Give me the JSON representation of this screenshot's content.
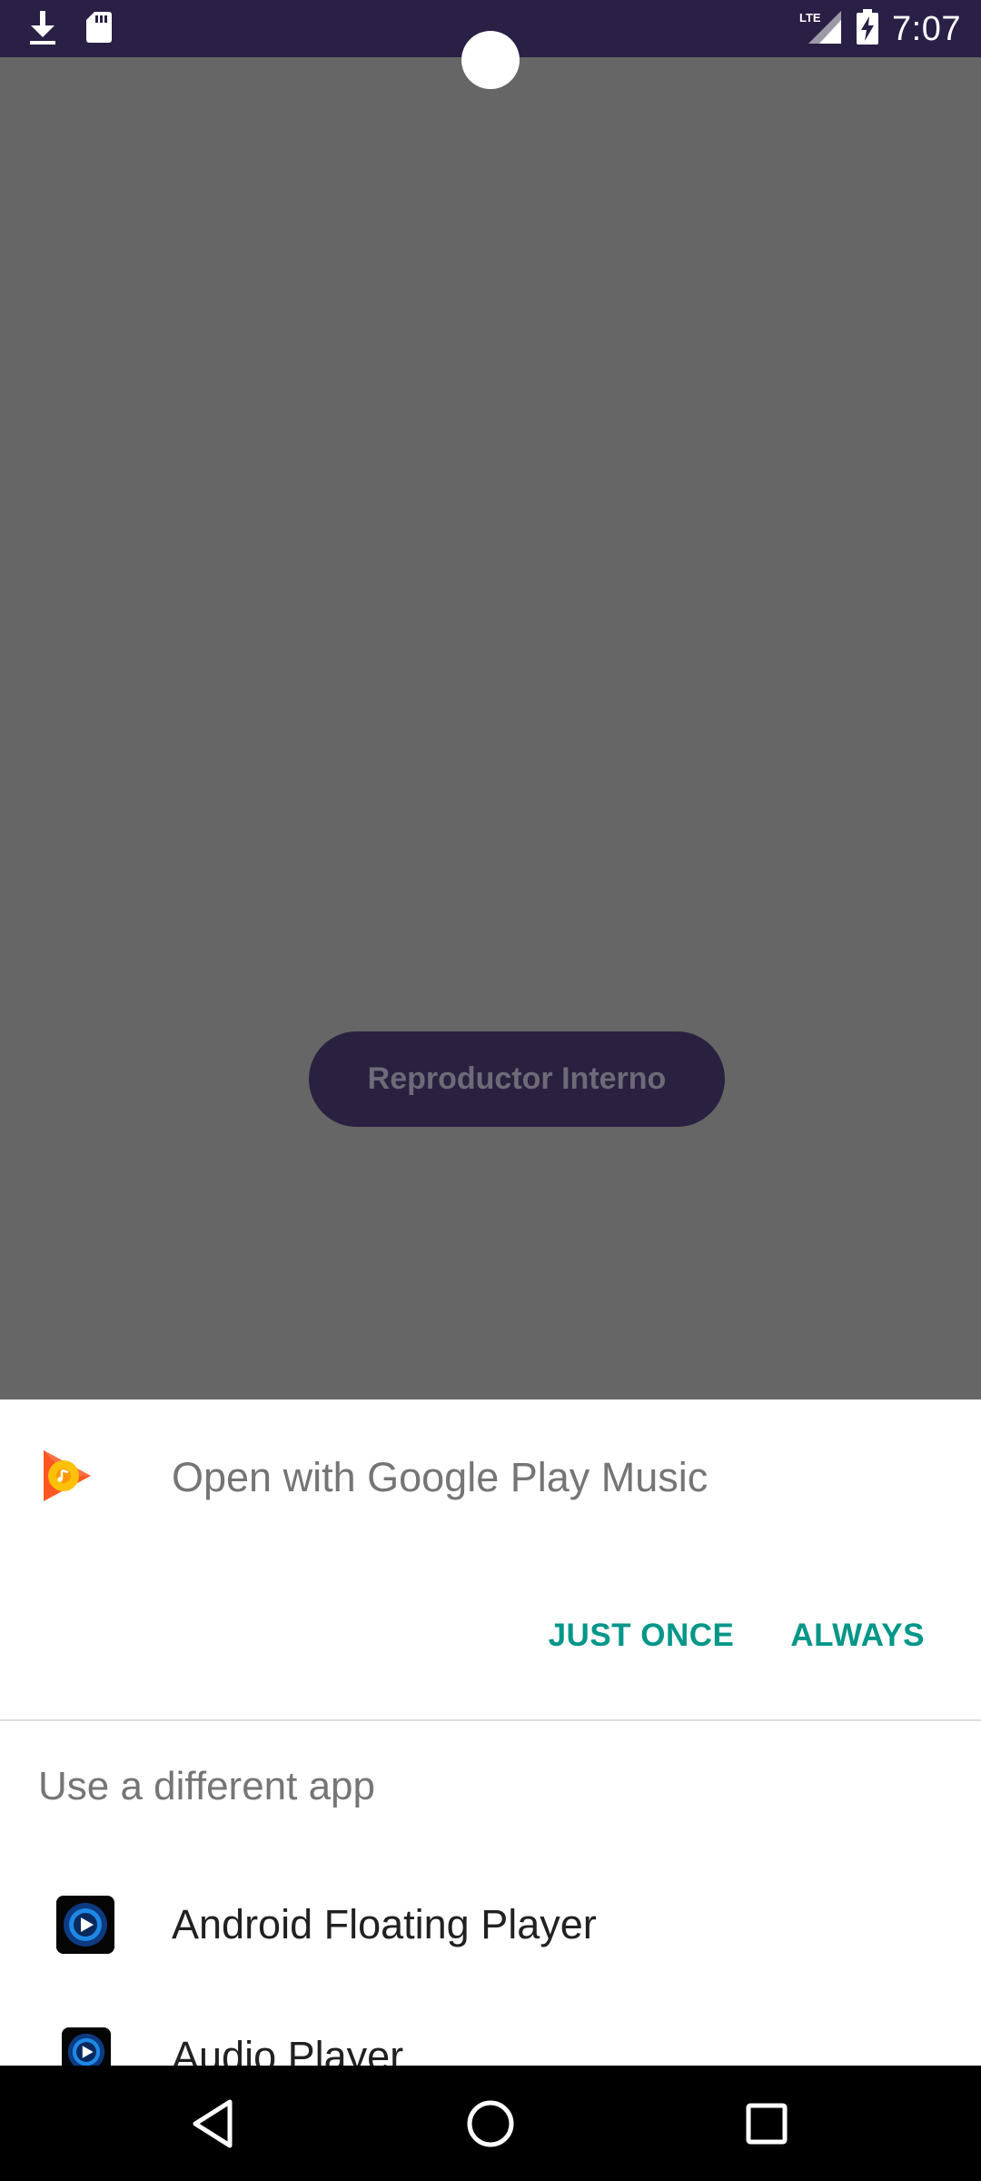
{
  "status_bar": {
    "time": "7:07",
    "network": "LTE",
    "icons": [
      "download-icon",
      "sd-card-icon",
      "lte-signal-icon",
      "battery-charging-icon"
    ]
  },
  "background_app": {
    "button_label": "Reproductor Interno"
  },
  "dialog": {
    "title": "Open with Google Play Music",
    "app_icon": "google-play-music-icon",
    "actions": {
      "just_once": "JUST ONCE",
      "always": "ALWAYS"
    },
    "section_label": "Use a different app",
    "apps": [
      {
        "label": "Android Floating Player",
        "icon": "floating-player-icon"
      },
      {
        "label": "Audio Player",
        "icon": "audio-player-icon"
      }
    ],
    "accent_color": "#009688"
  },
  "nav_bar": {
    "icons": [
      "back-icon",
      "home-icon",
      "recents-icon"
    ]
  }
}
